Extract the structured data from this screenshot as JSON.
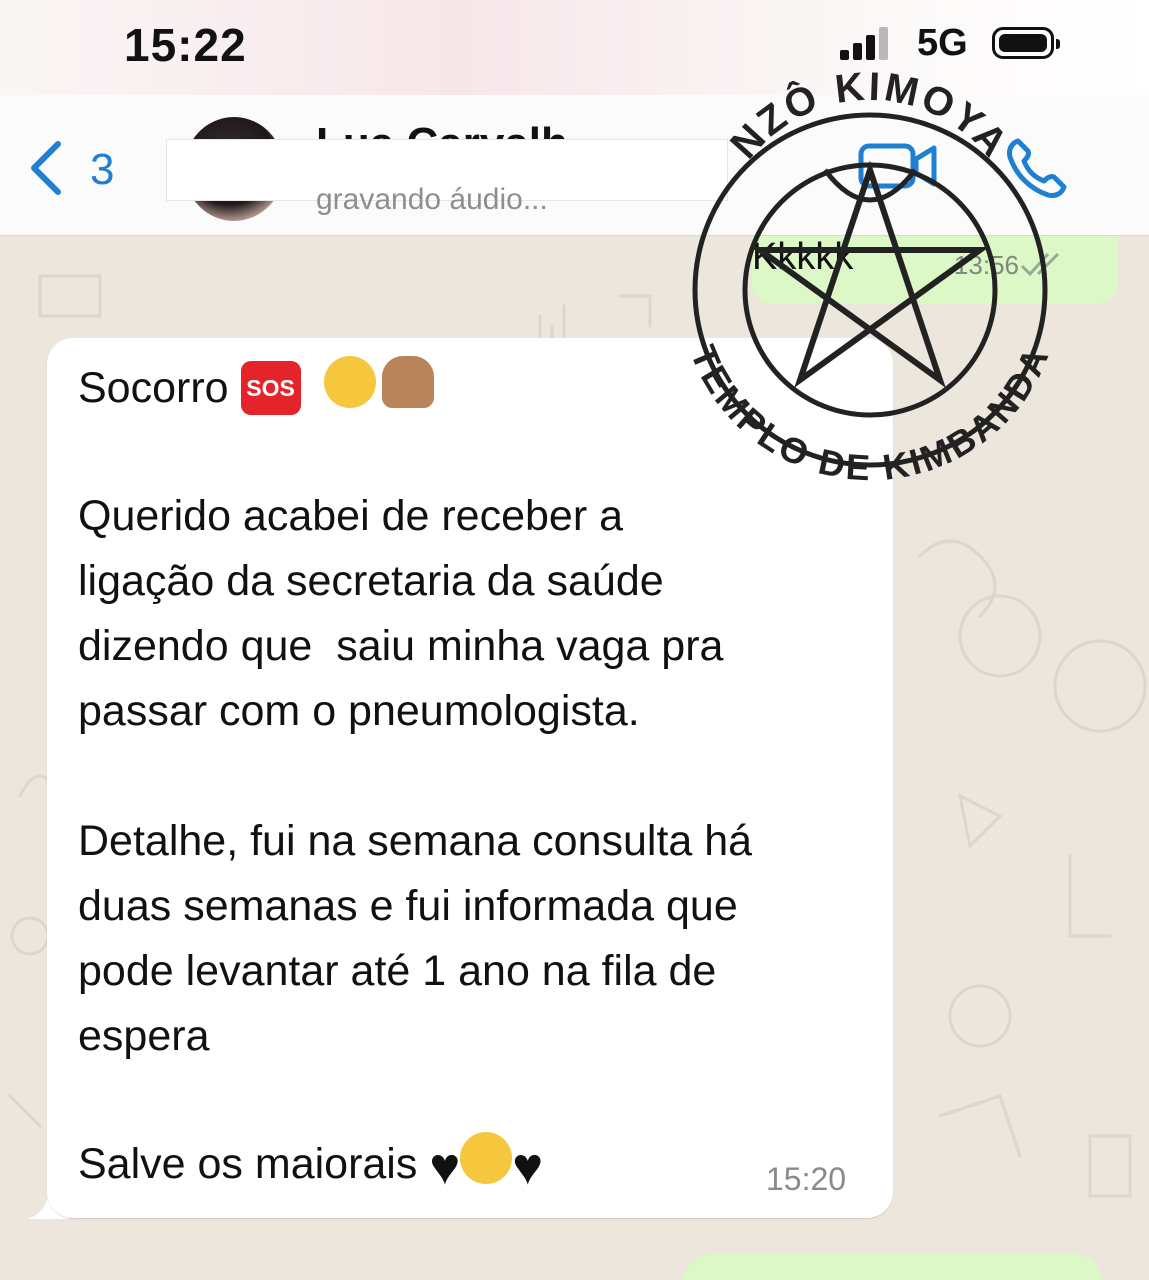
{
  "status_bar": {
    "time": "15:22",
    "network": "5G",
    "signal_bars": 3,
    "battery_icon": "battery-full-icon"
  },
  "header": {
    "back_icon": "chevron-left-icon",
    "back_count": "3",
    "contact_name": "Lua Carvalh",
    "status": "gravando áudio...",
    "video_icon": "video-camera-icon",
    "call_icon": "phone-icon",
    "accent": "#1f7fd0"
  },
  "chat": {
    "outgoing": {
      "text": "Kkkkk",
      "time": "13:56",
      "status_icon": "double-check-icon",
      "bubble_color": "#dcf8c6"
    },
    "incoming": {
      "line1": "Socorro",
      "sos_label": "SOS",
      "para1": [
        "Querido acabei de receber a",
        "ligação da secretaria da saúde",
        "dizendo que  saiu minha vaga pra",
        "passar com o pneumologista."
      ],
      "para2": [
        "Detalhe, fui na semana consulta há",
        "duas semanas e fui informada que",
        "pode levantar até 1 ano na fila de",
        "espera"
      ],
      "closing": "Salve os maiorais",
      "time": "15:20",
      "emoji_icons": [
        "sos-icon",
        "rolling-laughing-icon",
        "raising-hands-icon",
        "black-heart-icon",
        "grinning-face-icon",
        "black-heart-icon"
      ]
    },
    "background_color": "#ece6dd"
  },
  "watermark": {
    "top_text": "NZÔ KIMOYA",
    "bottom_text": "TEMPLO DE KIMBANDA",
    "icon": "pentagram-seal-icon"
  }
}
